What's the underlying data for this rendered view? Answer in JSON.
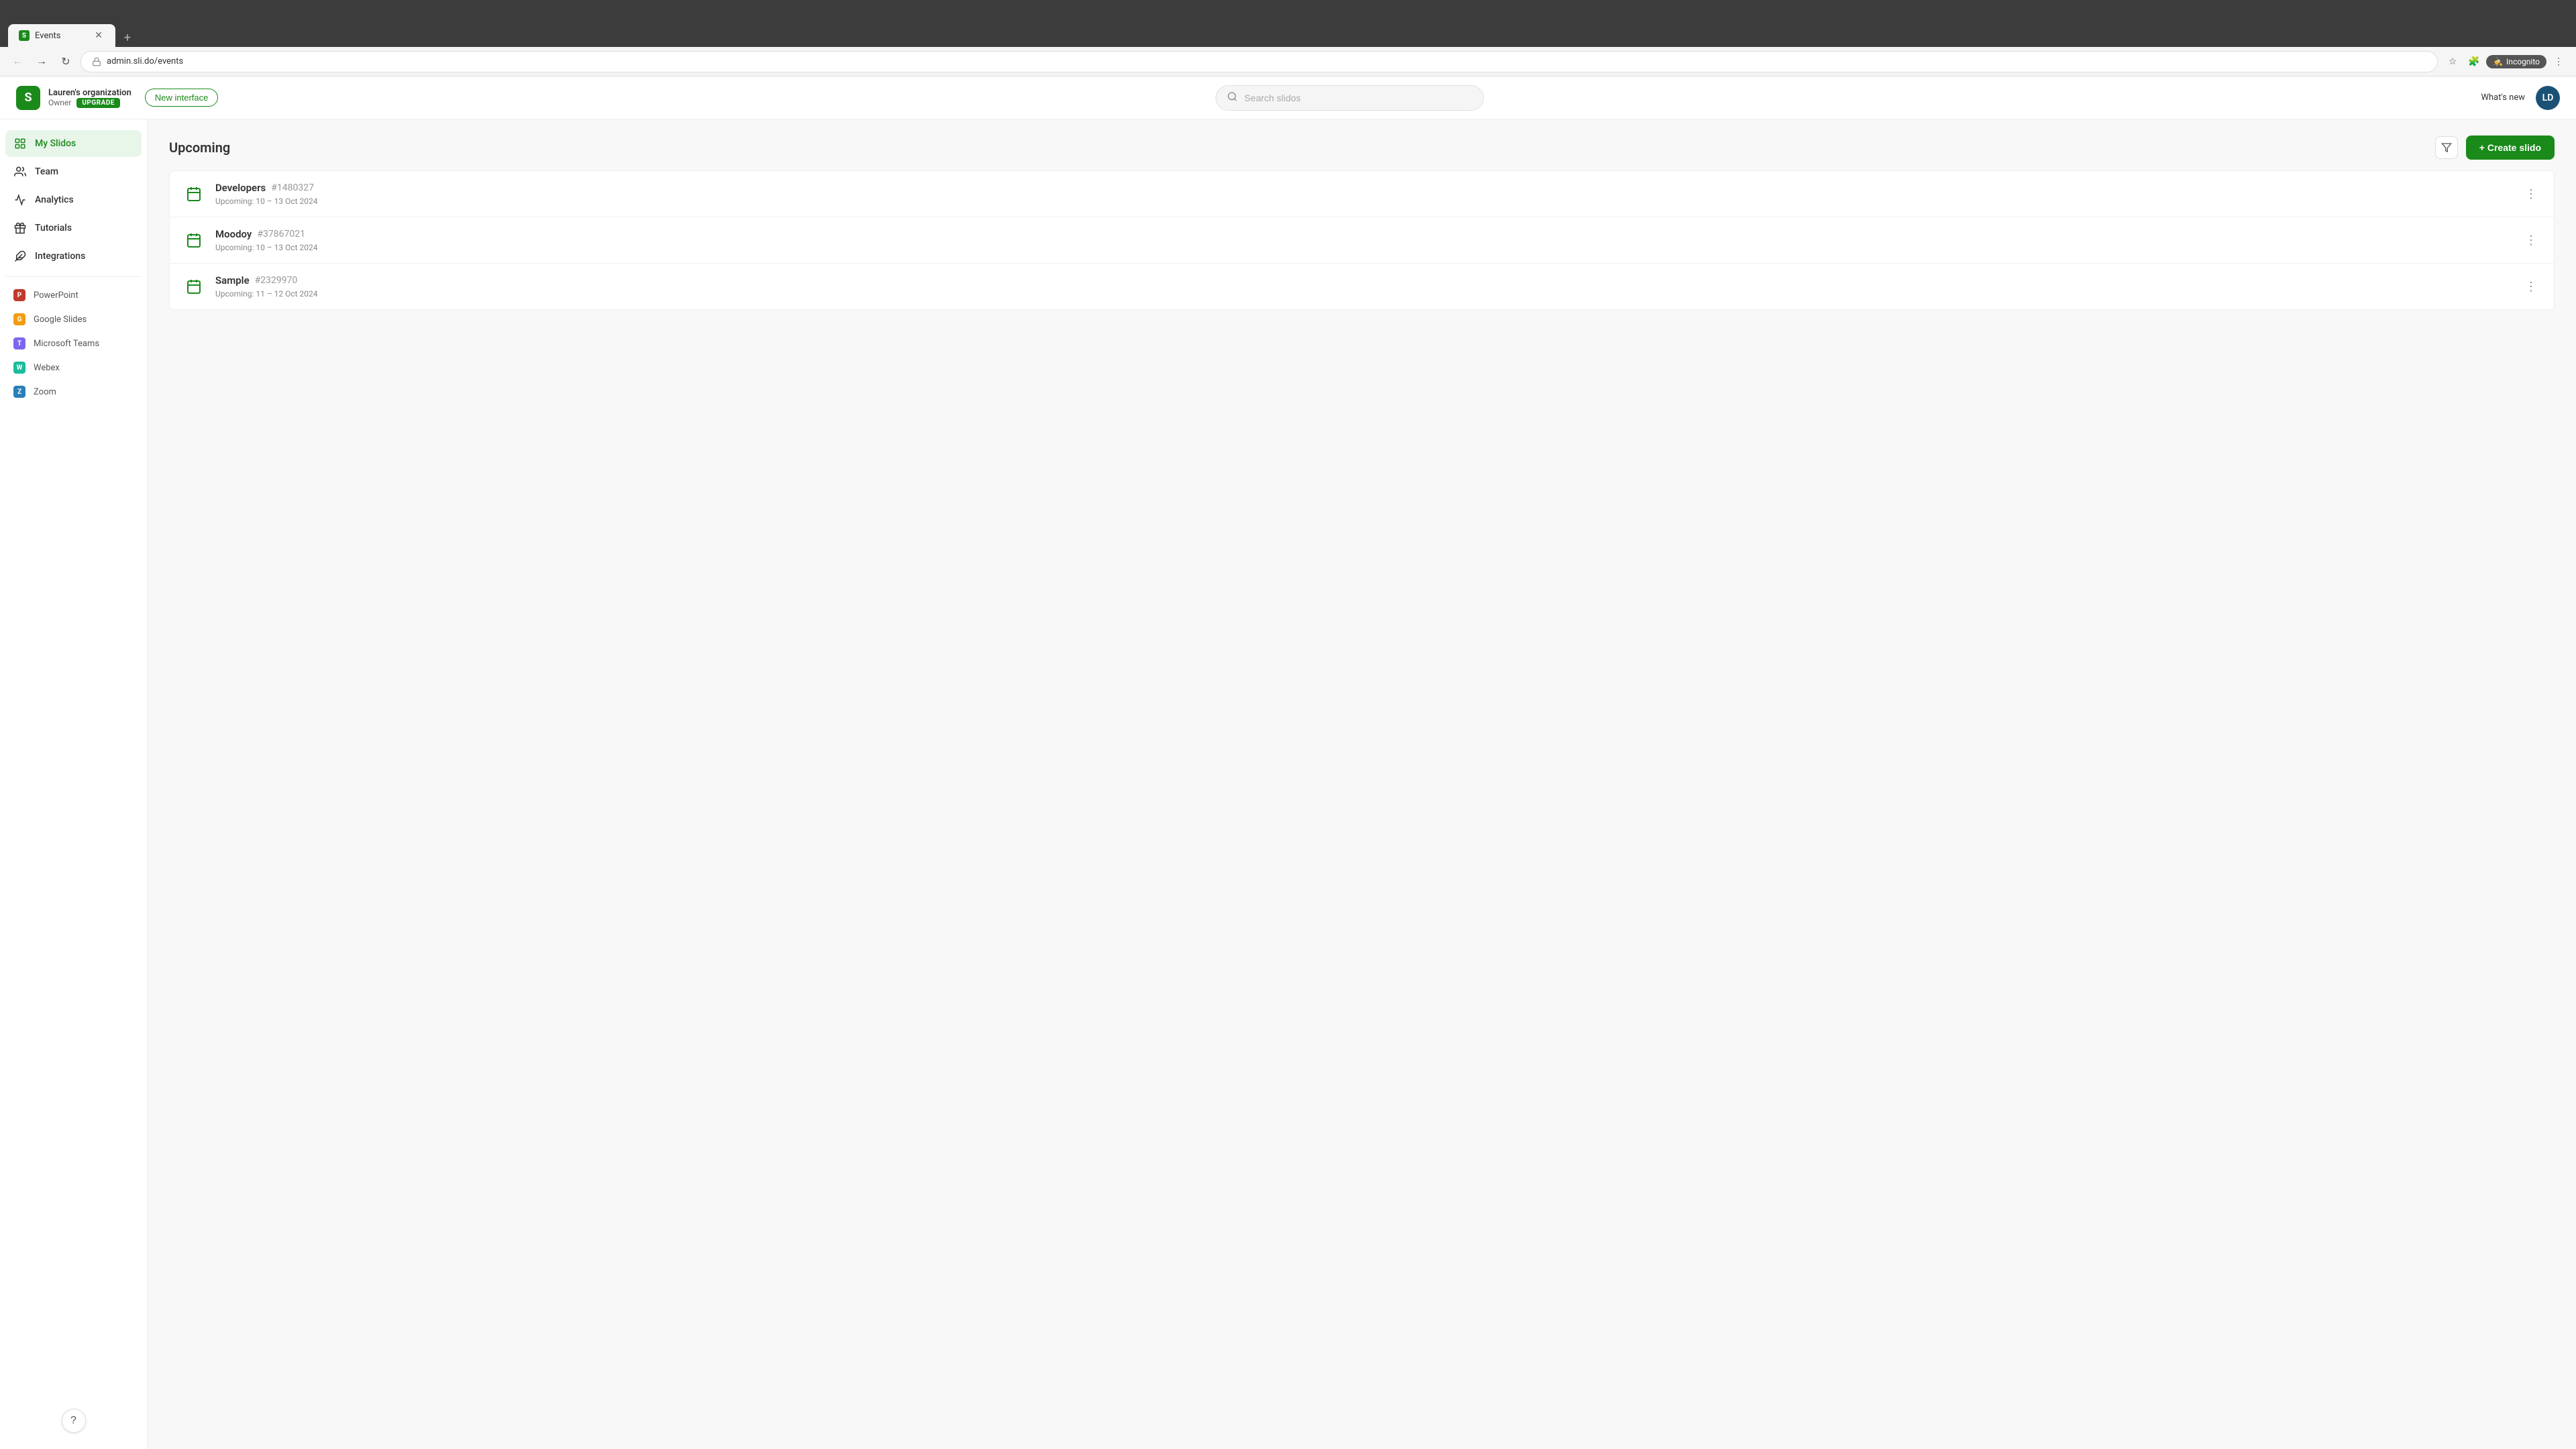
{
  "browser": {
    "tab": {
      "favicon": "S",
      "title": "Events",
      "url": "admin.sli.do/events"
    },
    "nav": {
      "back_disabled": false,
      "forward_disabled": true
    },
    "toolbar": {
      "incognito_label": "Incognito"
    }
  },
  "header": {
    "logo_letter": "S",
    "org_name": "Lauren's organization",
    "org_role": "Owner",
    "upgrade_label": "UPGRADE",
    "new_interface_label": "New interface",
    "search_placeholder": "Search slidos",
    "whats_new_label": "What's new",
    "avatar_initials": "LD"
  },
  "sidebar": {
    "items": [
      {
        "id": "my-slidos",
        "label": "My Slidos",
        "icon": "grid",
        "active": true
      },
      {
        "id": "team",
        "label": "Team",
        "icon": "people",
        "active": false
      },
      {
        "id": "analytics",
        "label": "Analytics",
        "icon": "chart",
        "active": false
      },
      {
        "id": "tutorials",
        "label": "Tutorials",
        "icon": "gift",
        "active": false
      },
      {
        "id": "integrations",
        "label": "Integrations",
        "icon": "puzzle",
        "active": false
      }
    ],
    "integrations": [
      {
        "id": "powerpoint",
        "label": "PowerPoint",
        "color": "#c0392b",
        "icon": "P"
      },
      {
        "id": "google-slides",
        "label": "Google Slides",
        "color": "#f39c12",
        "icon": "G"
      },
      {
        "id": "microsoft-teams",
        "label": "Microsoft Teams",
        "color": "#7b68ee",
        "icon": "T"
      },
      {
        "id": "webex",
        "label": "Webex",
        "color": "#1abc9c",
        "icon": "W"
      },
      {
        "id": "zoom",
        "label": "Zoom",
        "color": "#2980b9",
        "icon": "Z"
      }
    ],
    "help_label": "?"
  },
  "content": {
    "section_title": "Upcoming",
    "filter_label": "Filter",
    "create_button_label": "+ Create slido",
    "events": [
      {
        "id": "event-1",
        "name": "Developers",
        "event_id": "#1480327",
        "date_label": "Upcoming: 10 – 13 Oct 2024"
      },
      {
        "id": "event-2",
        "name": "Moodoy",
        "event_id": "#37867021",
        "date_label": "Upcoming: 10 – 13 Oct 2024"
      },
      {
        "id": "event-3",
        "name": "Sample",
        "event_id": "#2329970",
        "date_label": "Upcoming: 11 – 12 Oct 2024"
      }
    ]
  },
  "colors": {
    "brand_green": "#1a8a1a",
    "accent_green_light": "#e8f5e9"
  }
}
